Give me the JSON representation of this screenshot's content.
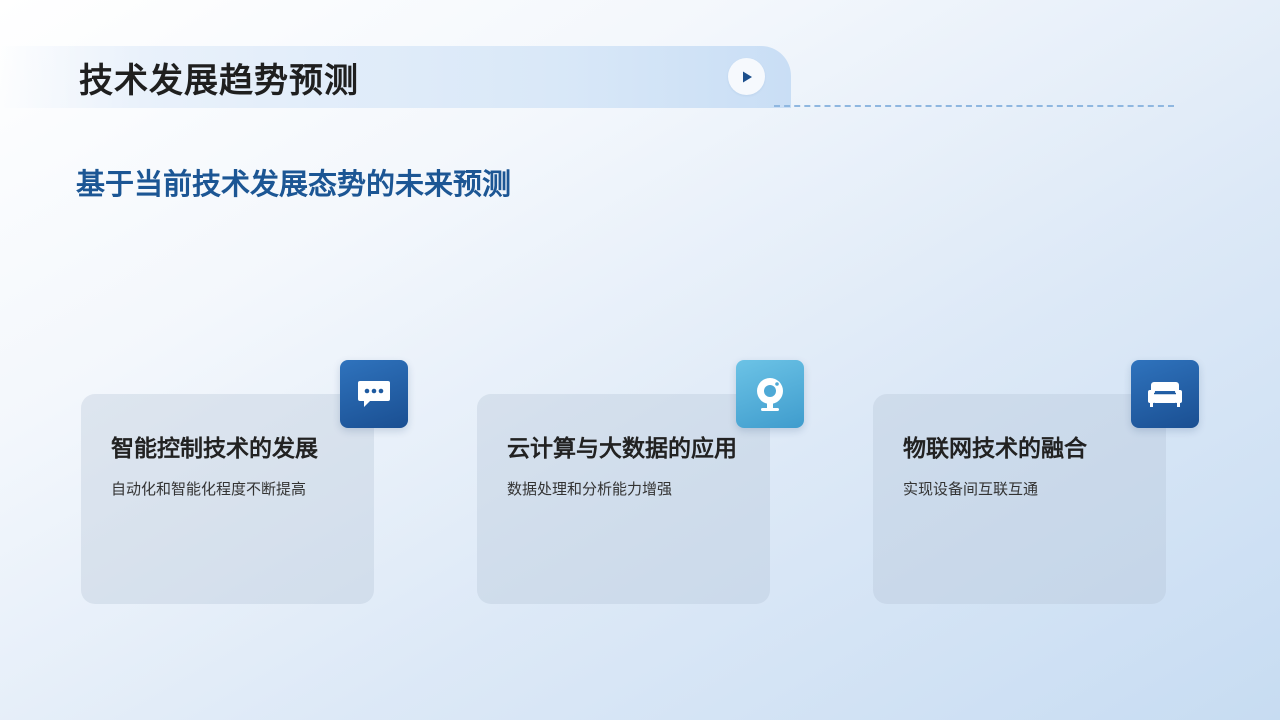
{
  "header": {
    "title": "技术发展趋势预测",
    "play_icon": "play-icon"
  },
  "subtitle": "基于当前技术发展态势的未来预测",
  "colors": {
    "title": "#1f1f1f",
    "subtitle": "#1c5694",
    "icon_dark_blue": "#1e5aa0",
    "icon_light_blue": "#5bb3dc"
  },
  "cards": [
    {
      "title": "智能控制技术的发展",
      "description": "自动化和智能化程度不断提高",
      "icon": "chat-bubble-icon"
    },
    {
      "title": "云计算与大数据的应用",
      "description": "数据处理和分析能力增强",
      "icon": "webcam-icon"
    },
    {
      "title": "物联网技术的融合",
      "description": "实现设备间互联互通",
      "icon": "sofa-icon"
    }
  ]
}
